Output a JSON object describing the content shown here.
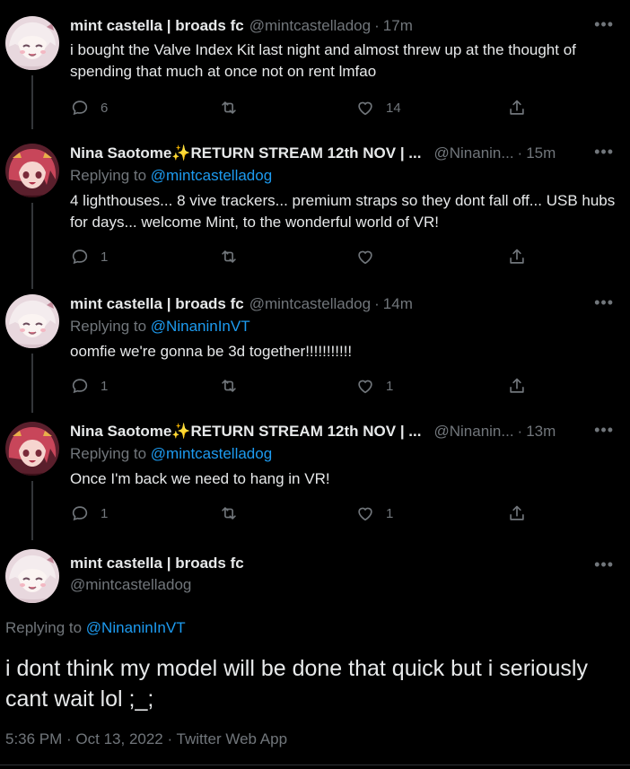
{
  "tweets": [
    {
      "name": "mint castella | broads fc",
      "handle": "@mintcastelladog",
      "time": "17m",
      "text": "i bought the Valve Index Kit last night and almost threw up at the thought of spending that much at once not on rent lmfao",
      "reply_count": "6",
      "retweet_count": "",
      "like_count": "14"
    },
    {
      "name": "Nina Saotome✨RETURN STREAM 12th NOV | ...",
      "handle": "@Ninanin...",
      "time": "15m",
      "replying_prefix": "Replying to",
      "replying_to": "@mintcastelladog",
      "text": "4 lighthouses... 8 vive trackers... premium straps so they dont fall off... USB hubs for days... welcome Mint, to the wonderful world of VR!",
      "reply_count": "1",
      "retweet_count": "",
      "like_count": ""
    },
    {
      "name": "mint castella | broads fc",
      "handle": "@mintcastelladog",
      "time": "14m",
      "replying_prefix": "Replying to",
      "replying_to": "@NinaninInVT",
      "text": "oomfie we're gonna be 3d together!!!!!!!!!!!",
      "reply_count": "1",
      "retweet_count": "",
      "like_count": "1"
    },
    {
      "name": "Nina Saotome✨RETURN STREAM 12th NOV | ...",
      "handle": "@Ninanin...",
      "time": "13m",
      "replying_prefix": "Replying to",
      "replying_to": "@mintcastelladog",
      "text": "Once I'm back we need to hang in VR!",
      "reply_count": "1",
      "retweet_count": "",
      "like_count": "1"
    }
  ],
  "main": {
    "name": "mint castella | broads fc",
    "handle": "@mintcastelladog",
    "replying_prefix": "Replying to",
    "replying_to": "@NinaninInVT",
    "text": "i dont think my model will be done that quick but i seriously cant wait lol ;_;",
    "timestamp": "5:36 PM · Oct 13, 2022 · Twitter Web App"
  },
  "ui": {
    "dot": "·",
    "more_glyph": "•••"
  },
  "colors": {
    "background": "#000000",
    "text_primary": "#e7e9ea",
    "text_secondary": "#71767b",
    "link": "#1d9bf0"
  },
  "icons": {
    "reply": "reply-icon",
    "retweet": "retweet-icon",
    "like": "like-icon",
    "share": "share-icon",
    "more": "more-icon"
  }
}
